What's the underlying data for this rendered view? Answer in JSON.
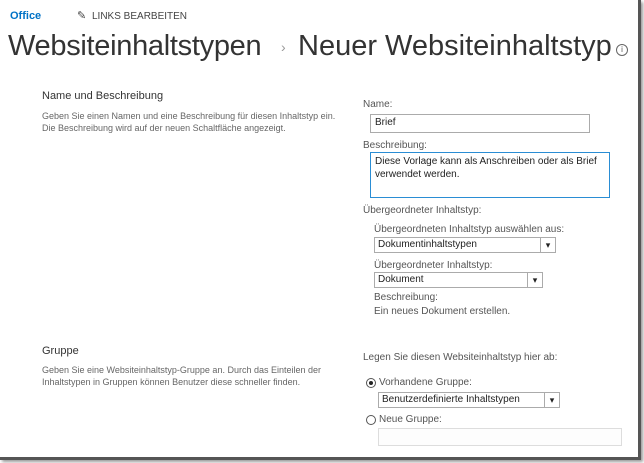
{
  "nav": {
    "office": "Office",
    "edit_links": "LINKS BEARBEITEN"
  },
  "title": {
    "parent": "Websiteinhaltstypen",
    "separator": "›",
    "current": "Neuer Websiteinhaltstyp",
    "info": "i"
  },
  "section_name": {
    "heading": "Name und Beschreibung",
    "desc1": "Geben Sie einen Namen und eine Beschreibung für diesen Inhaltstyp ein.",
    "desc2": "Die Beschreibung wird auf der neuen Schaltfläche angezeigt."
  },
  "form": {
    "name_label": "Name:",
    "name_value": "Brief",
    "desc_label": "Beschreibung:",
    "desc_value": "Diese Vorlage kann als Anschreiben oder als Brief verwendet werden.",
    "parent_label": "Übergeordneter Inhaltstyp:",
    "parent_from_label": "Übergeordneten Inhaltstyp auswählen aus:",
    "parent_from_value": "Dokumentinhaltstypen",
    "parent_type_label": "Übergeordneter Inhaltstyp:",
    "parent_type_value": "Dokument",
    "parent_desc_label": "Beschreibung:",
    "parent_desc_value": "Ein neues Dokument erstellen."
  },
  "section_group": {
    "heading": "Gruppe",
    "desc1": "Geben Sie eine Websiteinhaltstyp-Gruppe an. Durch das Einteilen der",
    "desc2": "Inhaltstypen in Gruppen können Benutzer diese schneller finden."
  },
  "group": {
    "label": "Legen Sie diesen Websiteinhaltstyp hier ab:",
    "existing_label": "Vorhandene Gruppe:",
    "existing_value": "Benutzerdefinierte Inhaltstypen",
    "new_label": "Neue Gruppe:",
    "new_value": ""
  },
  "arrow": "▾"
}
